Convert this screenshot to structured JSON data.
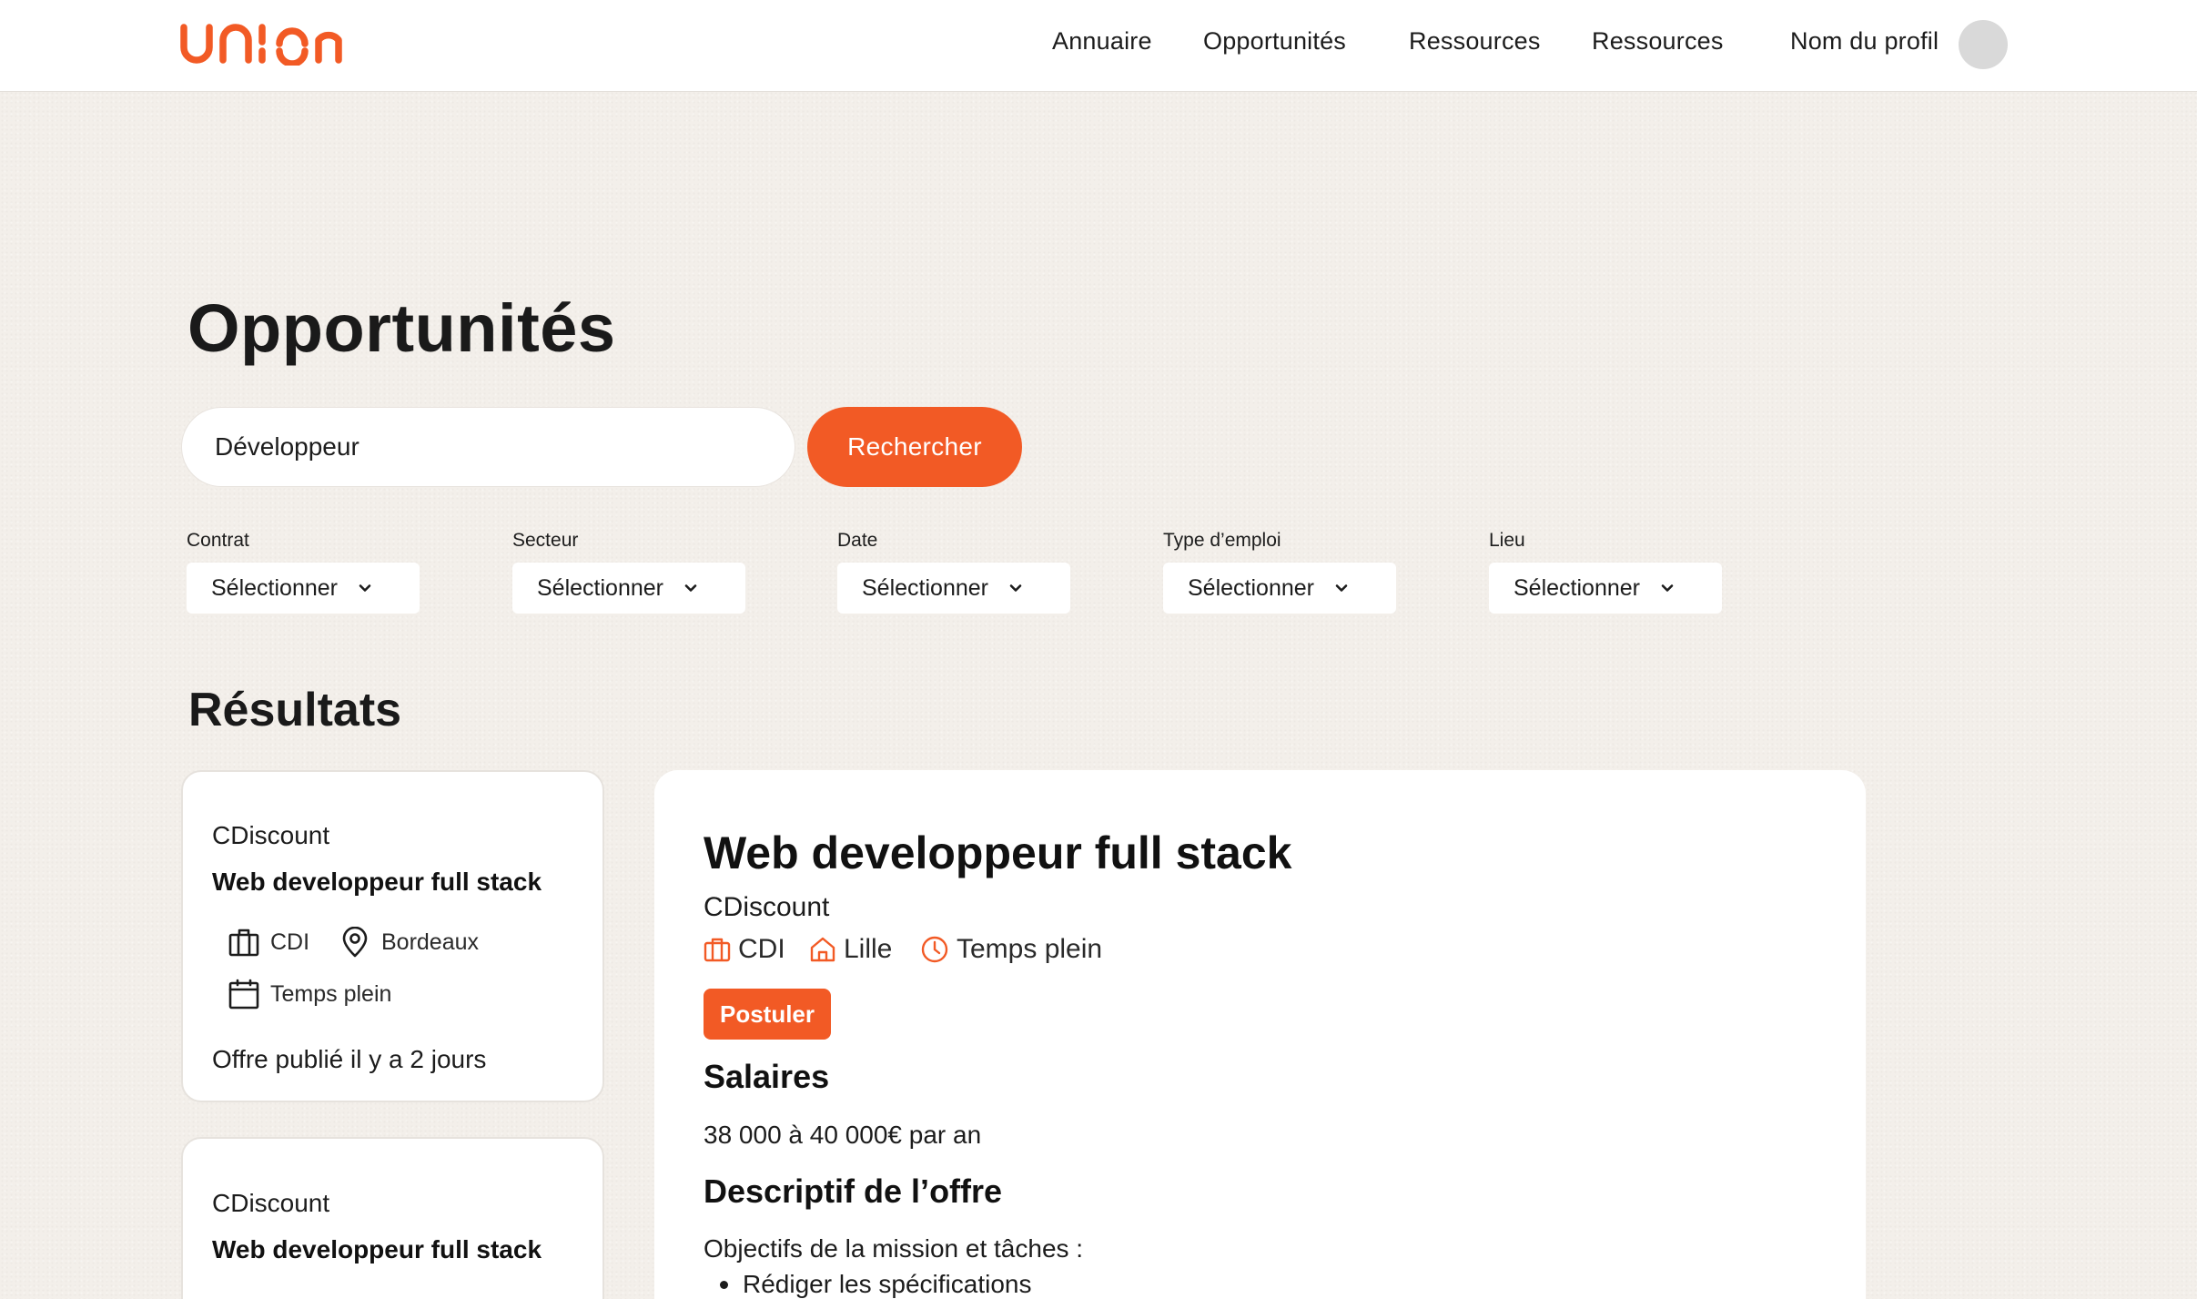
{
  "header": {
    "nav": [
      "Annuaire",
      "Opportunités",
      "Ressources",
      "Ressources"
    ],
    "profile_name": "Nom du profil"
  },
  "brand": {
    "logo_text": "union",
    "accent": "#f25a25"
  },
  "page": {
    "title": "Opportunités"
  },
  "search": {
    "value": "Développeur",
    "button_label": "Rechercher"
  },
  "filters": [
    {
      "label": "Contrat",
      "value": "Sélectionner"
    },
    {
      "label": "Secteur",
      "value": "Sélectionner"
    },
    {
      "label": "Date",
      "value": "Sélectionner"
    },
    {
      "label": "Type d’emploi",
      "value": "Sélectionner"
    },
    {
      "label": "Lieu",
      "value": "Sélectionner"
    }
  ],
  "results": {
    "title": "Résultats",
    "cards": [
      {
        "company": "CDiscount",
        "title": "Web developpeur full stack",
        "contract": "CDI",
        "location": "Bordeaux",
        "schedule": "Temps plein",
        "posted": "Offre publié il y a 2 jours"
      },
      {
        "company": "CDiscount",
        "title": "Web developpeur full stack"
      }
    ]
  },
  "detail": {
    "title": "Web developpeur full stack",
    "company": "CDiscount",
    "contract": "CDI",
    "location": "Lille",
    "schedule": "Temps plein",
    "apply_label": "Postuler",
    "salary_title": "Salaires",
    "salary_value": "38 000 à 40 000€ par an",
    "description_title": "Descriptif de l’offre",
    "description_intro": "Objectifs de la mission et tâches :",
    "bullets": [
      "Rédiger les spécifications"
    ]
  }
}
